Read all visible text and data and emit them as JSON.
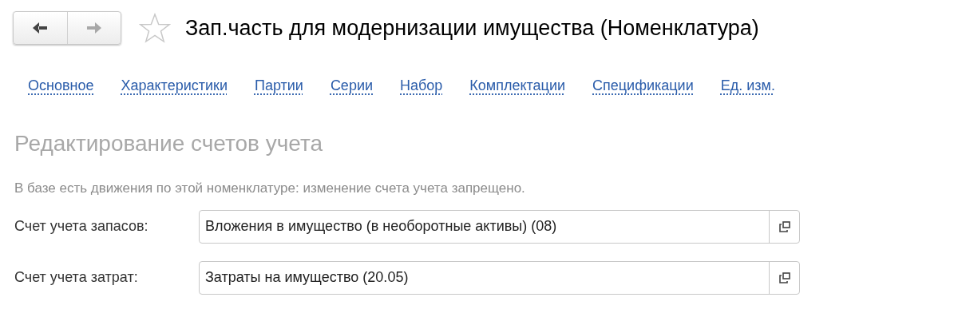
{
  "toolbar": {
    "nav_buttons": [
      {
        "kind": "back",
        "disabled": false
      },
      {
        "kind": "forward",
        "disabled": true
      }
    ],
    "favorite": {
      "checked": false
    }
  },
  "window": {
    "title": "Зап.часть для модернизации имущества (Номенклатура)"
  },
  "nav_links": [
    {
      "label": "Основное"
    },
    {
      "label": "Характеристики"
    },
    {
      "label": "Партии"
    },
    {
      "label": "Серии"
    },
    {
      "label": "Набор"
    },
    {
      "label": "Комплектации"
    },
    {
      "label": "Спецификации"
    },
    {
      "label": "Ед. изм."
    }
  ],
  "section": {
    "heading": "Редактирование счетов учета",
    "note": "В базе есть движения по этой номенклатуре: изменение счета учета запрещено."
  },
  "fields": [
    {
      "label": "Счет учета запасов:",
      "value": "Вложения в имущество (в необоротные активы) (08)"
    },
    {
      "label": "Счет учета затрат:",
      "value": "Затраты на имущество (20.05)"
    }
  ]
}
